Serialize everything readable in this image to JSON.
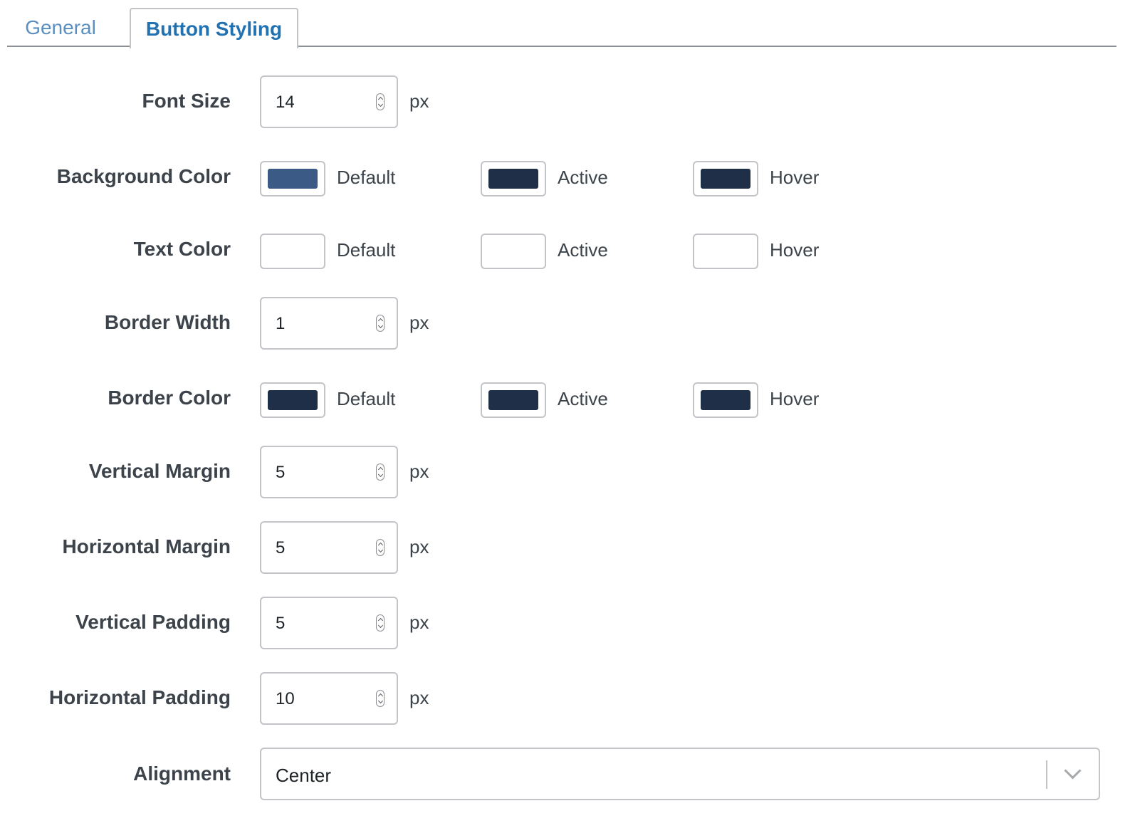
{
  "tabs": [
    {
      "label": "General",
      "active": false
    },
    {
      "label": "Button Styling",
      "active": true
    }
  ],
  "fields": {
    "font_size": {
      "label": "Font Size",
      "value": "14",
      "unit": "px"
    },
    "background_color": {
      "label": "Background Color",
      "default": {
        "label": "Default",
        "color": "#3b5a85"
      },
      "active": {
        "label": "Active",
        "color": "#1f2f47"
      },
      "hover": {
        "label": "Hover",
        "color": "#1f2f47"
      }
    },
    "text_color": {
      "label": "Text Color",
      "default": {
        "label": "Default",
        "color": "#ffffff"
      },
      "active": {
        "label": "Active",
        "color": "#ffffff"
      },
      "hover": {
        "label": "Hover",
        "color": "#ffffff"
      }
    },
    "border_width": {
      "label": "Border Width",
      "value": "1",
      "unit": "px"
    },
    "border_color": {
      "label": "Border Color",
      "default": {
        "label": "Default",
        "color": "#1f2f47"
      },
      "active": {
        "label": "Active",
        "color": "#1f2f47"
      },
      "hover": {
        "label": "Hover",
        "color": "#1f2f47"
      }
    },
    "vertical_margin": {
      "label": "Vertical Margin",
      "value": "5",
      "unit": "px"
    },
    "horizontal_margin": {
      "label": "Horizontal Margin",
      "value": "5",
      "unit": "px"
    },
    "vertical_padding": {
      "label": "Vertical Padding",
      "value": "5",
      "unit": "px"
    },
    "horizontal_padding": {
      "label": "Horizontal Padding",
      "value": "10",
      "unit": "px"
    },
    "alignment": {
      "label": "Alignment",
      "value": "Center"
    }
  },
  "colors": {
    "tab_active": "#2271b1",
    "tab_inactive": "#5b8fc0",
    "border": "#c3c4c7"
  }
}
